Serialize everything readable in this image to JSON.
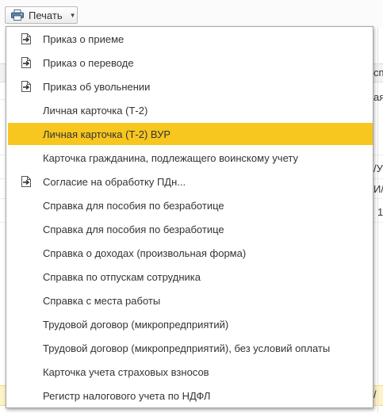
{
  "toolbar": {
    "print_button_label": "Печать"
  },
  "background_fragments": [
    "сп",
    "ая",
    "/У",
    "И/",
    "1",
    "/"
  ],
  "menu": {
    "selected_index": 4,
    "items": [
      {
        "label": "Приказ о приеме",
        "icon": "document-arrow-icon"
      },
      {
        "label": "Приказ о переводе",
        "icon": "document-arrow-icon"
      },
      {
        "label": "Приказ об увольнении",
        "icon": "document-arrow-icon"
      },
      {
        "label": "Личная карточка (Т-2)",
        "icon": ""
      },
      {
        "label": "Личная карточка (Т-2) ВУР",
        "icon": ""
      },
      {
        "label": "Карточка гражданина, подлежащего воинскому учету",
        "icon": ""
      },
      {
        "label": "Согласие на обработку ПДн...",
        "icon": "document-arrow-icon"
      },
      {
        "label": "Справка для пособия по безработице",
        "icon": ""
      },
      {
        "label": "Справка для пособия по безработице",
        "icon": ""
      },
      {
        "label": "Справка о доходах (произвольная форма)",
        "icon": ""
      },
      {
        "label": "Справка по отпускам сотрудника",
        "icon": ""
      },
      {
        "label": "Справка с места работы",
        "icon": ""
      },
      {
        "label": "Трудовой договор (микропредприятий)",
        "icon": ""
      },
      {
        "label": "Трудовой договор (микропредприятий), без условий оплаты",
        "icon": ""
      },
      {
        "label": "Карточка учета страховых взносов",
        "icon": ""
      },
      {
        "label": "Регистр налогового учета по НДФЛ",
        "icon": ""
      }
    ]
  },
  "colors": {
    "highlight": "#f7c61f",
    "text": "#333333",
    "row_highlight_bg": "#fff2c4"
  }
}
